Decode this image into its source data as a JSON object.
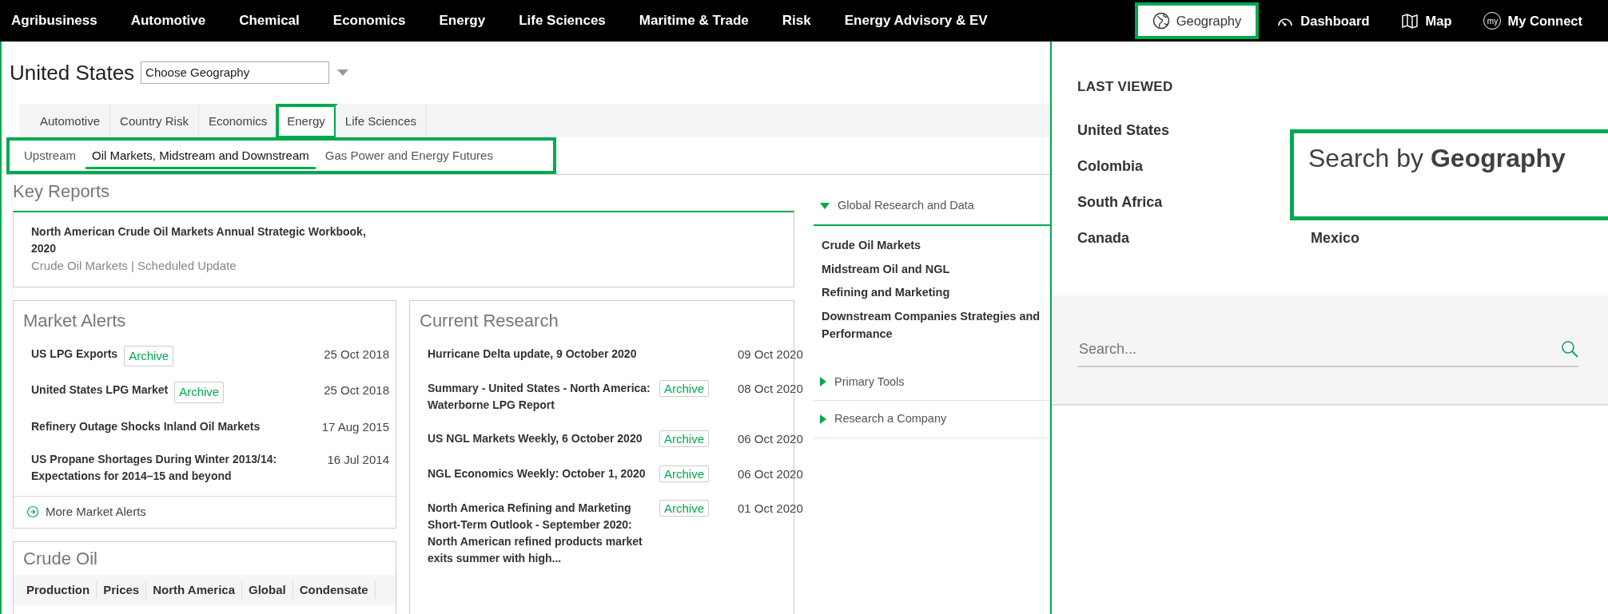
{
  "top_nav": {
    "items": [
      {
        "label": "Agribusiness",
        "selected": false
      },
      {
        "label": "Automotive",
        "selected": false
      },
      {
        "label": "Chemical",
        "selected": false
      },
      {
        "label": "Economics",
        "selected": false
      },
      {
        "label": "Energy",
        "selected": false
      },
      {
        "label": "Life Sciences",
        "selected": false
      },
      {
        "label": "Maritime & Trade",
        "selected": false
      },
      {
        "label": "Risk",
        "selected": false
      },
      {
        "label": "Energy Advisory & EV",
        "selected": false
      }
    ],
    "tools": [
      {
        "label": "Geography",
        "selected": true,
        "highlighted": true
      },
      {
        "label": "Dashboard",
        "selected": false,
        "highlighted": false
      },
      {
        "label": "Map",
        "selected": false,
        "highlighted": false
      },
      {
        "label": "My Connect",
        "icon_text": "my",
        "selected": false,
        "highlighted": false
      }
    ]
  },
  "geography": {
    "title": "United States",
    "select_value": "Choose Geography"
  },
  "tabs": [
    {
      "label": "Automotive",
      "selected": false,
      "highlighted": false
    },
    {
      "label": "Country Risk",
      "selected": false,
      "highlighted": false
    },
    {
      "label": "Economics",
      "selected": false,
      "highlighted": false
    },
    {
      "label": "Energy",
      "selected": true,
      "highlighted": true
    },
    {
      "label": "Life Sciences",
      "selected": false,
      "highlighted": false
    }
  ],
  "subtabs": {
    "highlighted": true,
    "items": [
      {
        "label": "Upstream",
        "selected": false
      },
      {
        "label": "Oil Markets, Midstream and Downstream",
        "selected": true
      },
      {
        "label": "Gas Power and Energy Futures",
        "selected": false
      }
    ]
  },
  "key_reports": {
    "title": "Key Reports",
    "items": [
      {
        "title": "North American Crude Oil Markets Annual Strategic Workbook, 2020",
        "meta": "Crude Oil Markets | Scheduled Update"
      }
    ]
  },
  "market_alerts": {
    "title": "Market Alerts",
    "items": [
      {
        "title": "US LPG Exports",
        "badge": "Archive",
        "date": "25 Oct 2018"
      },
      {
        "title": "United States LPG Market",
        "badge": "Archive",
        "date": "25 Oct 2018"
      },
      {
        "title": "Refinery Outage Shocks Inland Oil Markets",
        "date": "17 Aug 2015"
      },
      {
        "title": "US Propane Shortages During Winter 2013/14: Expectations for 2014–15 and beyond",
        "date": "16 Jul 2014"
      }
    ],
    "more_link": "More Market Alerts"
  },
  "current_research": {
    "title": "Current Research",
    "items": [
      {
        "title": "Hurricane Delta update, 9 October 2020",
        "date": "09 Oct 2020"
      },
      {
        "title": "Summary - United States - North America: Waterborne LPG Report",
        "badge": "Archive",
        "date": "08 Oct 2020"
      },
      {
        "title": "US NGL Markets Weekly, 6 October 2020",
        "badge": "Archive",
        "date": "06 Oct 2020"
      },
      {
        "title": "NGL Economics Weekly: October 1, 2020",
        "badge": "Archive",
        "date": "06 Oct 2020"
      },
      {
        "title": "North America Refining and Marketing Short-Term Outlook - September 2020: North American refined products market exits summer with high...",
        "badge": "Archive",
        "date": "01 Oct 2020"
      }
    ]
  },
  "crude_oil": {
    "title": "Crude Oil",
    "tabs": [
      "Production",
      "Prices",
      "North America",
      "Global",
      "Condensate"
    ]
  },
  "sidebar": {
    "sections": [
      {
        "label": "Global Research and Data",
        "expanded": true,
        "links": [
          "Crude Oil Markets",
          "Midstream Oil and NGL",
          "Refining and Marketing",
          "Downstream Companies Strategies and Performance"
        ]
      },
      {
        "label": "Primary Tools",
        "expanded": false
      },
      {
        "label": "Research a Company",
        "expanded": false
      }
    ]
  },
  "geo_panel": {
    "heading": "LAST VIEWED",
    "columns": [
      [
        "United States",
        "Colombia",
        "South Africa",
        "Canada"
      ],
      [
        "Mexico"
      ]
    ],
    "search_placeholder": "Search..."
  },
  "callout": {
    "text": "Search by **Geography**"
  }
}
